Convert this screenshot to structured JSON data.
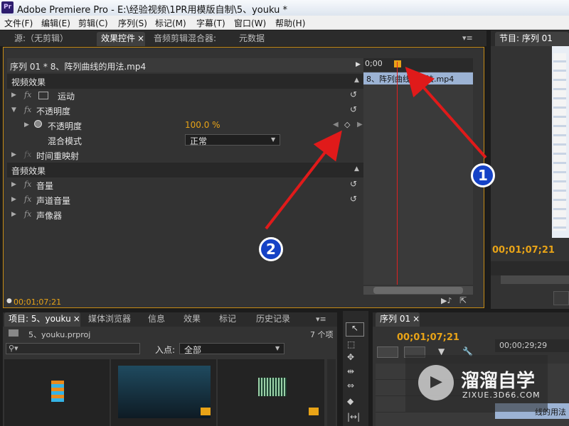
{
  "window": {
    "app_icon": "Pr",
    "title": "Adobe Premiere Pro - E:\\经验视频\\1PR用模版自制\\5、youku *"
  },
  "menu": [
    "文件(F)",
    "编辑(E)",
    "剪辑(C)",
    "序列(S)",
    "标记(M)",
    "字幕(T)",
    "窗口(W)",
    "帮助(H)"
  ],
  "source_tabs": {
    "tabs": [
      "源:（无剪辑）",
      "效果控件",
      "音频剪辑混合器:",
      "元数据"
    ],
    "active": "效果控件",
    "close": "×",
    "menu": "▾≡"
  },
  "program_tab": {
    "label": "节目: 序列 01",
    "timecode": "00;01;07;21"
  },
  "effect_controls": {
    "header": "序列 01 * 8、阵列曲线的用法.mp4",
    "video_section": "视频效果",
    "motion": "运动",
    "opacity": "不透明度",
    "opacity_param": "不透明度",
    "opacity_value": "100.0 %",
    "blend_mode_label": "混合模式",
    "blend_mode_value": "正常",
    "time_remap": "时间重映射",
    "audio_section": "音频效果",
    "volume": "音量",
    "channel_volume": "声道音量",
    "panner": "声像器",
    "fx": "fx",
    "timeline_start": "0;00",
    "clip_name": "8、阵列曲线的用法.mp4",
    "current_time": "00;01;07;21"
  },
  "project": {
    "tabs": [
      "项目: 5、youku",
      "媒体浏览器",
      "信息",
      "效果",
      "标记",
      "历史记录"
    ],
    "file": "5、youku.prproj",
    "item_count": "7 个项",
    "search_placeholder": "",
    "in_point_label": "入点:",
    "in_point_value": "全部"
  },
  "sequence": {
    "tab": "序列 01",
    "timecode": "00;01;07;21",
    "ruler_time": "00;00;29;29",
    "clip_name": "线的用法"
  },
  "watermark": {
    "title": "溜溜自学",
    "url": "ZIXUE.3D66.COM"
  },
  "annotations": [
    "1",
    "2"
  ],
  "colors": {
    "timecode": "#e8a317",
    "playhead": "#d22",
    "clip": "#9cb3d4",
    "accent_border": "#c68b14",
    "arrow": "#e01a1a"
  }
}
